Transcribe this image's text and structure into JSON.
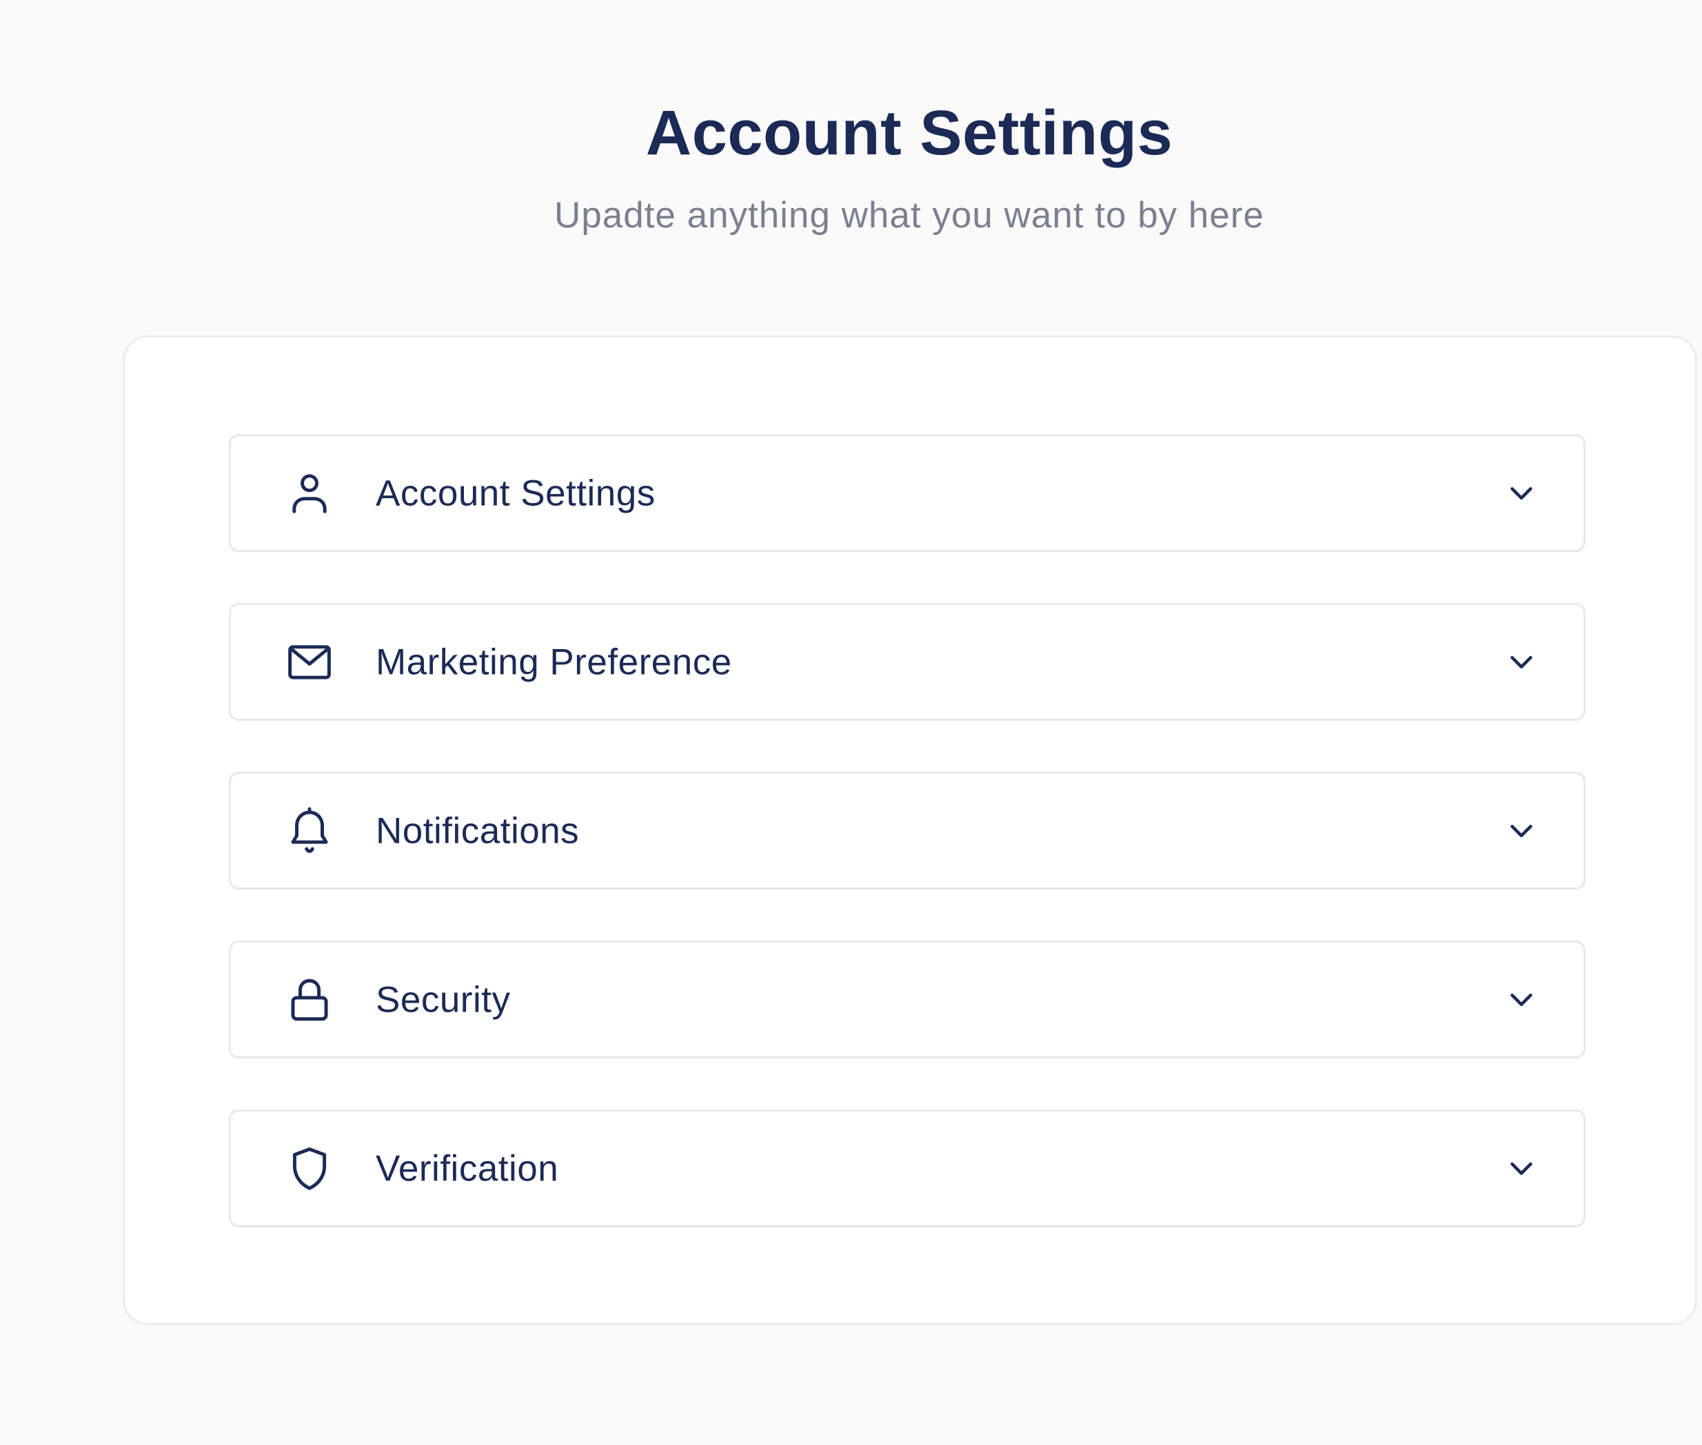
{
  "header": {
    "title": "Account Settings",
    "subtitle": "Upadte anything what you want to by here"
  },
  "colors": {
    "background": "#fafafa",
    "card": "#ffffff",
    "text_primary": "#1b2b55",
    "text_secondary": "#7a8090",
    "border": "#e8e8e8"
  },
  "sections": [
    {
      "label": "Account Settings",
      "icon": "user-icon",
      "expanded": false
    },
    {
      "label": "Marketing Preference",
      "icon": "mail-icon",
      "expanded": false
    },
    {
      "label": "Notifications",
      "icon": "bell-icon",
      "expanded": false
    },
    {
      "label": "Security",
      "icon": "lock-icon",
      "expanded": false
    },
    {
      "label": "Verification",
      "icon": "shield-icon",
      "expanded": false
    }
  ]
}
